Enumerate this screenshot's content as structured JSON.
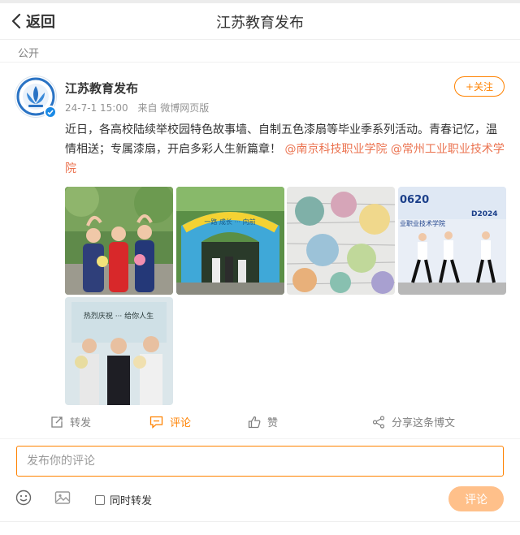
{
  "header": {
    "back_label": "返回",
    "title": "江苏教育发布"
  },
  "post": {
    "visibility": "公开",
    "author": "江苏教育发布",
    "follow_label": "+关注",
    "time": "24-7-1 15:00",
    "source": "来自 微博网页版",
    "text": "近日，各高校陆续举校园特色故事墙、自制五色漆扇等毕业季系列活动。青春记忆，温情相送；专属漆扇，开启多彩人生新篇章！",
    "mentions": [
      "@南京科技职业学院",
      "@常州工业职业技术学院"
    ],
    "photos": [
      {
        "name": "graduates-heart-pose"
      },
      {
        "name": "campus-story-arch",
        "sign_text": "一路 成长 ··· 向前"
      },
      {
        "name": "lacquer-fans-wall"
      },
      {
        "name": "graduates-stage-walk",
        "text_top": "0620",
        "text_board": "业职业技术学院",
        "text_date": "D2024"
      },
      {
        "name": "students-holding-fans",
        "text_banner": "热烈庆祝 ··· 给你人生"
      }
    ]
  },
  "actions": {
    "repost": "转发",
    "comment": "评论",
    "like": "赞",
    "share": "分享这条博文"
  },
  "comment_box": {
    "placeholder": "发布你的评论",
    "repost_option": "同时转发",
    "submit": "评论"
  },
  "colors": {
    "accent": "#ff8200",
    "mention": "#eb7350",
    "verify": "#1a8ae6"
  }
}
